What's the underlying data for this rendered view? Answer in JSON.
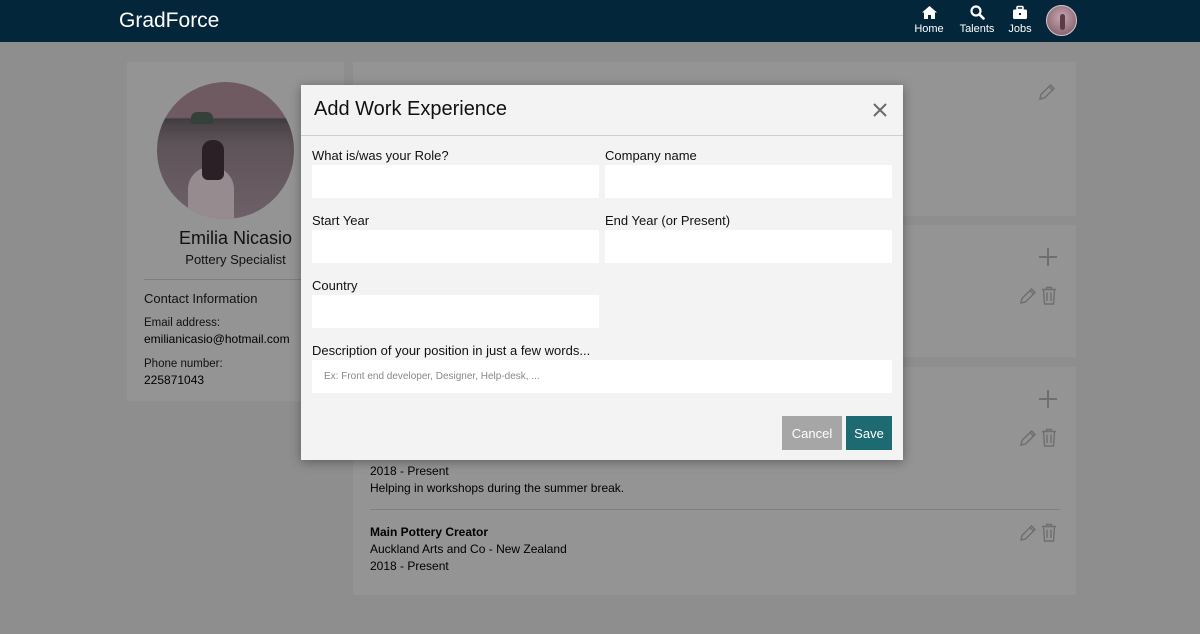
{
  "app": {
    "brand": "GradForce"
  },
  "nav": {
    "home": "Home",
    "talents": "Talents",
    "jobs": "Jobs"
  },
  "profile": {
    "name": "Emilia Nicasio",
    "title": "Pottery Specialist",
    "contact_heading": "Contact Information",
    "email_label": "Email address:",
    "email": "emilianicasio@hotmail.com",
    "phone_label": "Phone number:",
    "phone": "225871043"
  },
  "experience": [
    {
      "dates": "2018 - Present",
      "description": "Helping in workshops during the summer break."
    },
    {
      "role": "Main Pottery Creator",
      "company": "Auckland Arts and Co - New Zealand",
      "dates": "2018 - Present"
    }
  ],
  "modal": {
    "title": "Add Work Experience",
    "role_label": "What is/was your Role?",
    "company_label": "Company name",
    "start_label": "Start Year",
    "end_label": "End Year (or Present)",
    "country_label": "Country",
    "description_label": "Description of your position in just a few words...",
    "description_placeholder": "Ex: Front end developer, Designer, Help-desk, ...",
    "cancel_label": "Cancel",
    "save_label": "Save"
  },
  "colors": {
    "navbar": "#04263a",
    "save_button": "#1d6a72",
    "cancel_button": "#a6a6a6",
    "overlay_background": "#8e8e8e"
  },
  "icons": [
    "home-icon",
    "search-icon",
    "briefcase-icon",
    "close-icon",
    "pencil-icon",
    "trash-icon",
    "plus-icon"
  ]
}
